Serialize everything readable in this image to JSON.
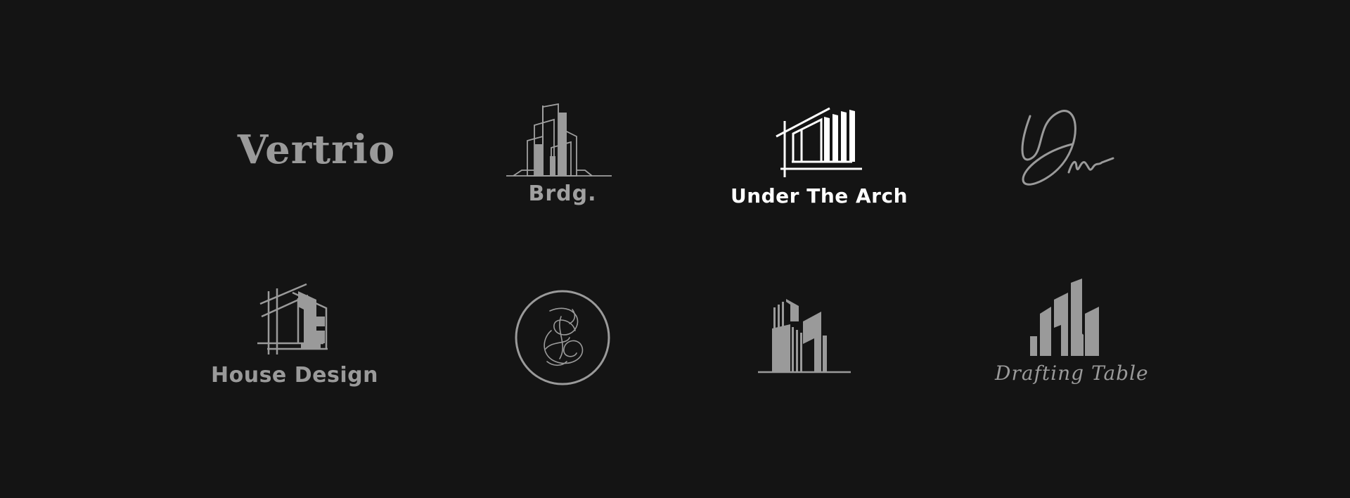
{
  "colors": {
    "background": "#141414",
    "gray": "#9a9a9a",
    "white": "#ffffff"
  },
  "logos": {
    "vertrio": {
      "name": "Vertrio",
      "icon": "wordmark"
    },
    "brdg": {
      "name": "Brdg.",
      "icon": "city-buildings-outline-icon"
    },
    "under_the_arch": {
      "name": "Under The Arch",
      "icon": "architect-frame-icon"
    },
    "dm": {
      "icon": "dm-signature-icon"
    },
    "house_design": {
      "name": "House Design",
      "icon": "house-blueprint-icon"
    },
    "monogram": {
      "icon": "ornate-monogram-circle-icon"
    },
    "skyline": {
      "icon": "skyscraper-skyline-icon"
    },
    "drafting_table": {
      "name": "Drafting Table",
      "icon": "tower-blocks-icon"
    }
  }
}
